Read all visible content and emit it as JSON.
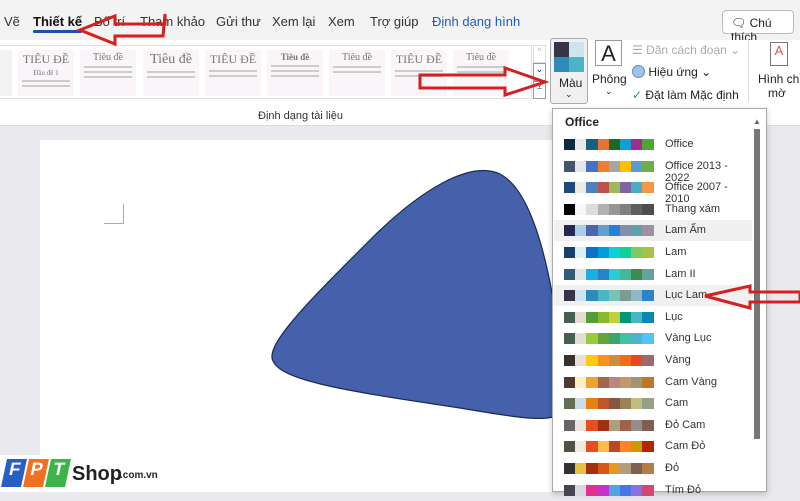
{
  "tabs": [
    "Vẽ",
    "Thiết kế",
    "Bố trí",
    "Tham khảo",
    "Gửi thư",
    "Xem lại",
    "Xem",
    "Trợ giúp",
    "Định dạng hình"
  ],
  "comment_button": "Chú thích",
  "gallery": {
    "thumbs": [
      "TIÊU ĐỀ",
      "Tiêu đề",
      "Tiêu đề",
      "TIÊU ĐỀ",
      "Tiêu đề",
      "Tiêu đề",
      "TIÊU ĐỀ",
      "Tiêu đề"
    ],
    "heading": "Đầu đề 1",
    "group_label": "Định dạng tài liệu"
  },
  "ribbon": {
    "colors": "Màu",
    "fonts_letter": "A",
    "fonts": "Phông",
    "paragraph_spacing": "Dãn cách đoạn",
    "effects": "Hiệu ứng",
    "set_default": "Đặt làm Mặc định",
    "watermark_1": "Hình chìm",
    "watermark_2": "mờ"
  },
  "dropdown": {
    "header": "Office",
    "selected": "Lục Lam",
    "items": [
      {
        "label": "Office",
        "colors": [
          "#0e2841",
          "#e8e8e8",
          "#156082",
          "#e97132",
          "#196b24",
          "#0f9ed5",
          "#a02b93",
          "#4ea72e"
        ]
      },
      {
        "label": "Office 2013 - 2022",
        "colors": [
          "#44546a",
          "#e7e6e6",
          "#4472c4",
          "#ed7d31",
          "#a5a5a5",
          "#ffc000",
          "#5b9bd5",
          "#70ad47"
        ]
      },
      {
        "label": "Office 2007 - 2010",
        "colors": [
          "#1f497d",
          "#eeece1",
          "#4f81bd",
          "#c0504d",
          "#9bbb59",
          "#8064a2",
          "#4bacc6",
          "#f79646"
        ]
      },
      {
        "label": "Thang xám",
        "colors": [
          "#000000",
          "#f8f8f8",
          "#dddddd",
          "#b2b2b2",
          "#969696",
          "#808080",
          "#5f5f5f",
          "#4d4d4d"
        ]
      },
      {
        "label": "Lam Ấm",
        "colors": [
          "#242852",
          "#acccea",
          "#4a66ac",
          "#629dd1",
          "#297fd5",
          "#7f8fa9",
          "#5aa2ae",
          "#9d90a0"
        ]
      },
      {
        "label": "Lam",
        "colors": [
          "#17406d",
          "#dbeff9",
          "#0f6fc6",
          "#009dd9",
          "#0bd0d9",
          "#10cf9b",
          "#7cca62",
          "#a5c249"
        ]
      },
      {
        "label": "Lam II",
        "colors": [
          "#335b74",
          "#dfe3e5",
          "#1cade4",
          "#2683c6",
          "#27ced7",
          "#42ba97",
          "#3e8853",
          "#62a39f"
        ]
      },
      {
        "label": "Lục Lam",
        "colors": [
          "#373545",
          "#cee4ee",
          "#2e8bb8",
          "#4ab5c4",
          "#76c4b1",
          "#7c9a96",
          "#8fb7c4",
          "#2c83c5"
        ]
      },
      {
        "label": "Lục",
        "colors": [
          "#455f51",
          "#e3ded1",
          "#549e39",
          "#8ab833",
          "#c0cf3a",
          "#029676",
          "#4ab5c4",
          "#0989b1"
        ]
      },
      {
        "label": "Vàng Lục",
        "colors": [
          "#455f51",
          "#e3ded1",
          "#99cb38",
          "#63a537",
          "#37a76f",
          "#44c1a3",
          "#4eb3cf",
          "#51c3f9"
        ]
      },
      {
        "label": "Vàng",
        "colors": [
          "#39302a",
          "#e5dedb",
          "#ffca08",
          "#f8931d",
          "#ce8d3e",
          "#ec7016",
          "#e64823",
          "#9c6a6a"
        ]
      },
      {
        "label": "Cam Vàng",
        "colors": [
          "#4e3b30",
          "#fbeec9",
          "#f0a22e",
          "#a5644e",
          "#b58b80",
          "#c3986d",
          "#a19574",
          "#c17529"
        ]
      },
      {
        "label": "Cam",
        "colors": [
          "#637052",
          "#ccddea",
          "#e48312",
          "#bd582c",
          "#865640",
          "#9b8357",
          "#c2bc80",
          "#94a088"
        ]
      },
      {
        "label": "Đỏ Cam",
        "colors": [
          "#696464",
          "#e9e5dc",
          "#e84c22",
          "#a5300f",
          "#b19c7d",
          "#a0614a",
          "#968c8c",
          "#7f5f52"
        ]
      },
      {
        "label": "Cam Đỏ",
        "colors": [
          "#505046",
          "#eeece1",
          "#e84c22",
          "#ffbd47",
          "#b64926",
          "#ff8427",
          "#cc9900",
          "#b22600"
        ]
      },
      {
        "label": "Đỏ",
        "colors": [
          "#323232",
          "#e5c243",
          "#a5300f",
          "#d55816",
          "#e19825",
          "#b19c7d",
          "#7f5f52",
          "#b27d49"
        ]
      },
      {
        "label": "Tím Đỏ",
        "colors": [
          "#454551",
          "#d8d9dc",
          "#e32d91",
          "#c830cc",
          "#4ea6dc",
          "#4775e7",
          "#8971e1",
          "#d54773"
        ]
      }
    ]
  },
  "logo": {
    "brand": "FPT",
    "suffix": "Shop",
    "domain": ".com.vn"
  }
}
